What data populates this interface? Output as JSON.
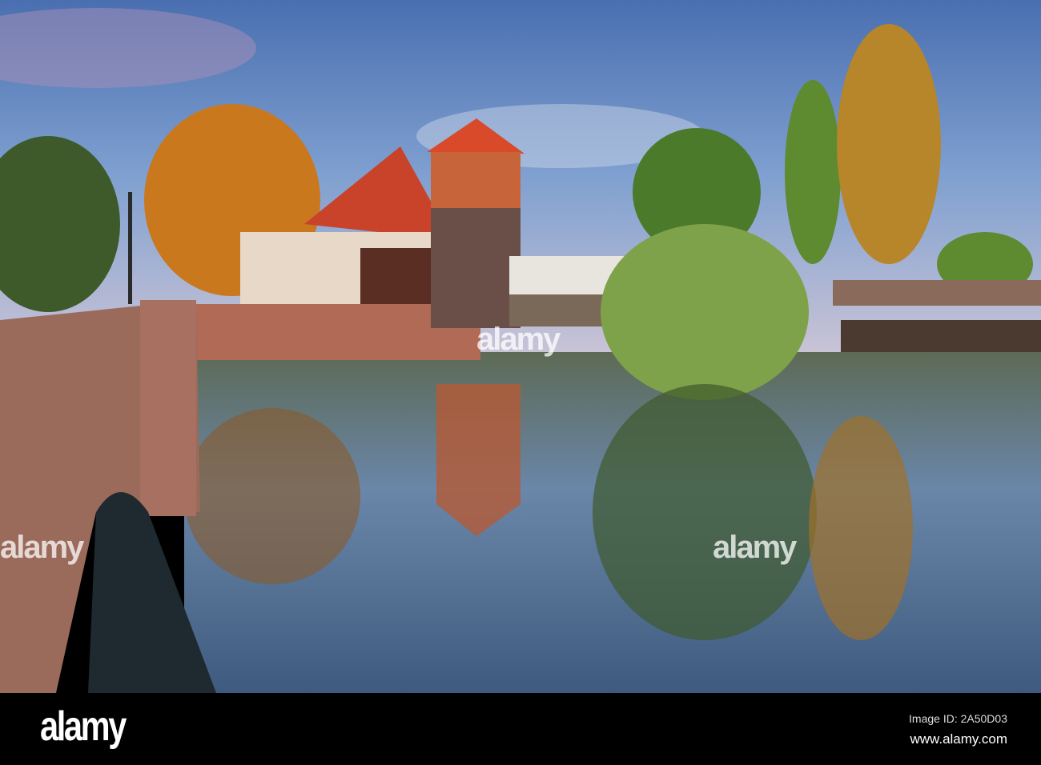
{
  "photo": {
    "subject": "river-town-scene"
  },
  "watermark": {
    "text": "alamy"
  },
  "footer": {
    "logo": "alamy",
    "image_id": "Image ID: 2A50D03",
    "url": "www.alamy.com"
  }
}
